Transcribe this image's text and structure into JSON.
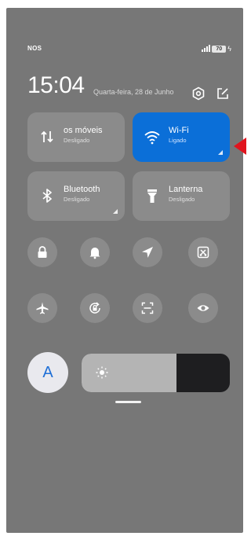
{
  "status_bar": {
    "carrier": "NOS",
    "battery_level": "70",
    "signal_bars": 4
  },
  "header": {
    "time": "15:04",
    "date": "Quarta-feira, 28 de Junho",
    "icons": [
      "settings-hexagon-icon",
      "edit-icon"
    ]
  },
  "tiles": [
    {
      "id": "mobile-data",
      "label": "os móveis",
      "state": "Desligado",
      "active": false,
      "icon": "mobile-data-arrows-icon"
    },
    {
      "id": "wifi",
      "label": "Wi-Fi",
      "state": "Ligado",
      "active": true,
      "icon": "wifi-icon"
    },
    {
      "id": "bluetooth",
      "label": "Bluetooth",
      "state": "Desligado",
      "active": false,
      "icon": "bluetooth-icon"
    },
    {
      "id": "flashlight",
      "label": "Lanterna",
      "state": "Desligado",
      "active": false,
      "icon": "flashlight-icon"
    }
  ],
  "toggles_row1": [
    "lock-icon",
    "bell-icon",
    "location-arrow-icon",
    "screenshot-scissors-icon"
  ],
  "toggles_row2": [
    "airplane-icon",
    "rotation-lock-icon",
    "scan-icon",
    "eye-icon"
  ],
  "avatar_letter": "A",
  "brightness": {
    "level": 0.64
  },
  "colors": {
    "panel_background": "#777777",
    "tile_inactive": "#8b8b8b",
    "tile_active": "#0b6fd8",
    "annotation_arrow": "#e0141e"
  }
}
